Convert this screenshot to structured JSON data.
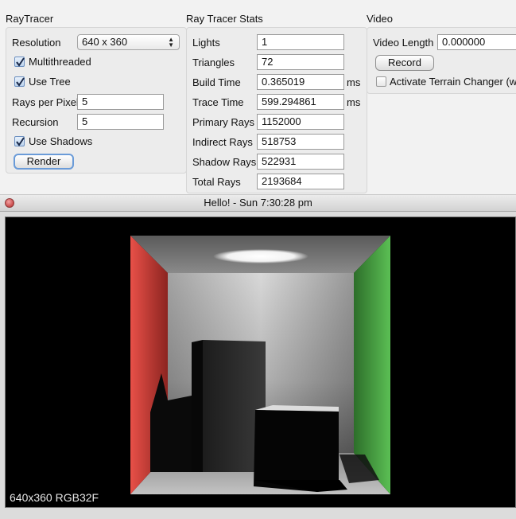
{
  "raytracer": {
    "title": "RayTracer",
    "resolution_label": "Resolution",
    "resolution_value": "640 x 360",
    "multithreaded_label": "Multithreaded",
    "multithreaded_checked": true,
    "use_tree_label": "Use Tree",
    "use_tree_checked": true,
    "rays_per_pixel_label": "Rays per Pixel",
    "rays_per_pixel_value": "5",
    "recursion_label": "Recursion",
    "recursion_value": "5",
    "use_shadows_label": "Use Shadows",
    "use_shadows_checked": true,
    "render_label": "Render"
  },
  "stats": {
    "title": "Ray Tracer Stats",
    "rows": [
      {
        "label": "Lights",
        "value": "1",
        "unit": ""
      },
      {
        "label": "Triangles",
        "value": "72",
        "unit": ""
      },
      {
        "label": "Build Time",
        "value": "0.365019",
        "unit": "ms"
      },
      {
        "label": "Trace Time",
        "value": "599.294861",
        "unit": "ms"
      },
      {
        "label": "Primary Rays",
        "value": "1152000",
        "unit": ""
      },
      {
        "label": "Indirect Rays",
        "value": "518753",
        "unit": ""
      },
      {
        "label": "Shadow Rays",
        "value": "522931",
        "unit": ""
      },
      {
        "label": "Total Rays",
        "value": "2193684",
        "unit": ""
      }
    ]
  },
  "video": {
    "title": "Video",
    "length_label": "Video Length",
    "length_value": "0.000000",
    "record_label": "Record",
    "terrain_label": "Activate Terrain Changer (w",
    "terrain_checked": false
  },
  "window": {
    "title": "Hello! - Sun 7:30:28 pm",
    "viewport_label": "640x360 RGB32F"
  },
  "colors": {
    "left_wall": "#e04a44",
    "right_wall": "#55b04e",
    "accent_checkbox": "#6b8fc0"
  }
}
